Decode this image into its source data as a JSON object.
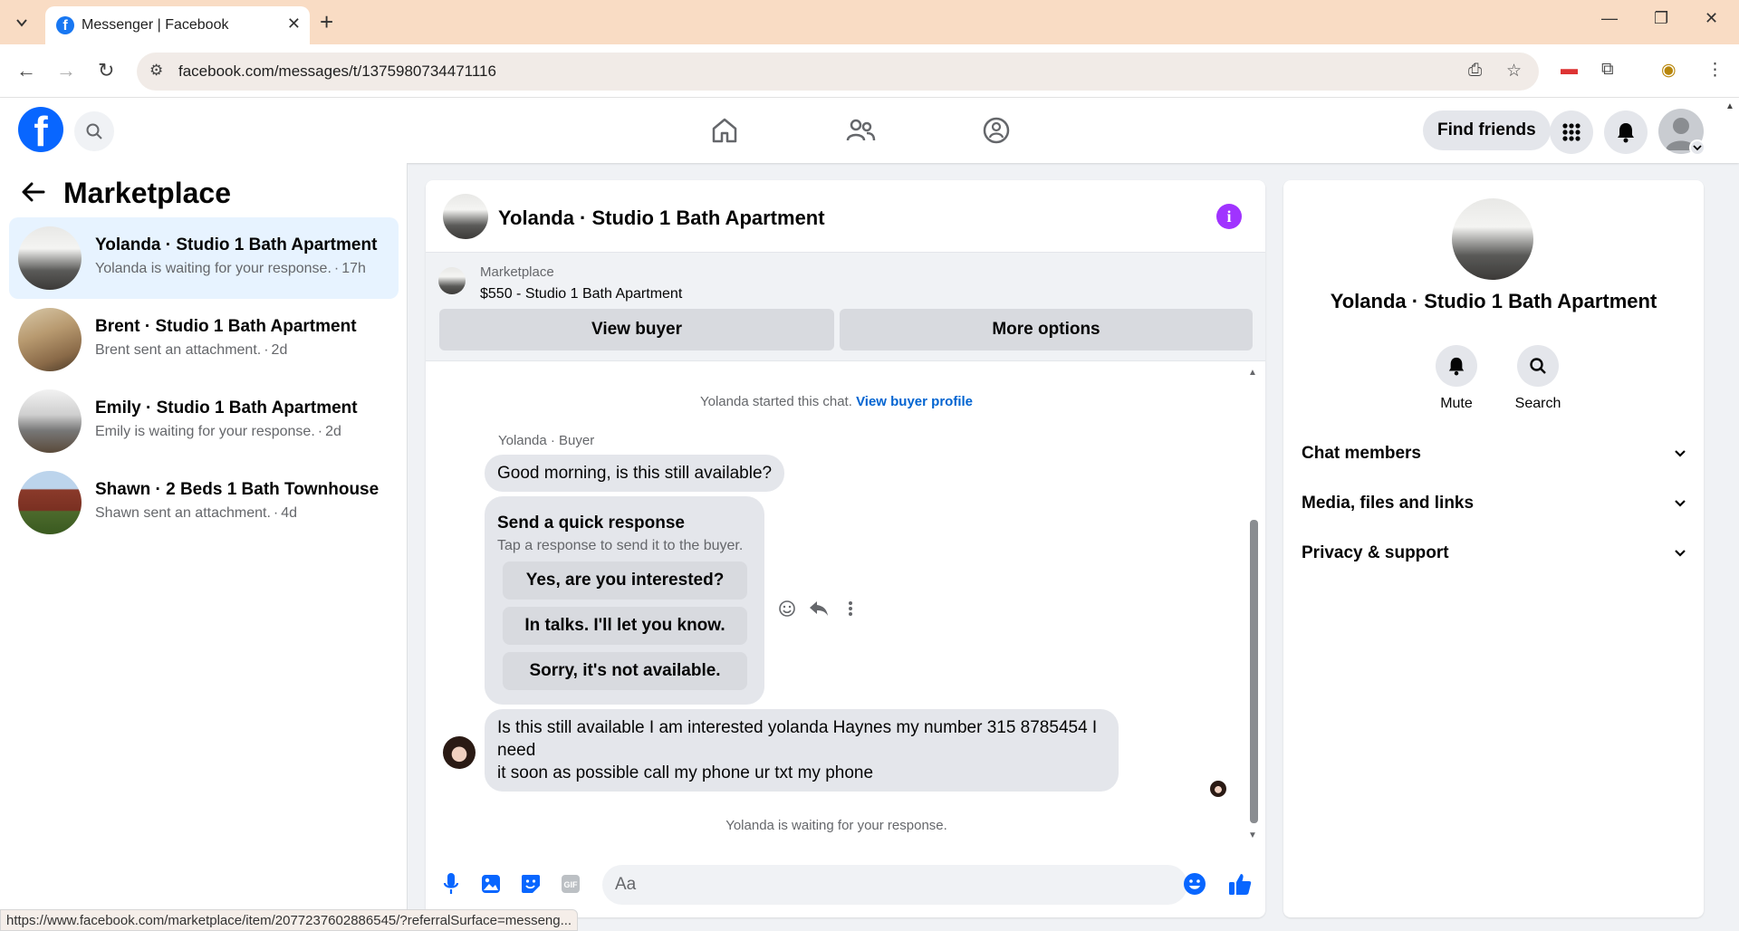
{
  "browser": {
    "tab_title": "Messenger | Facebook",
    "url": "facebook.com/messages/t/1375980734471116",
    "status_url": "https://www.facebook.com/marketplace/item/2077237602886545/?referralSurface=messeng..."
  },
  "header": {
    "find_friends_label": "Find friends"
  },
  "sidebar": {
    "title": "Marketplace",
    "conversations": [
      {
        "name": "Yolanda · Studio 1 Bath Apartment",
        "preview": "Yolanda is waiting for your response.",
        "time": "17h"
      },
      {
        "name": "Brent · Studio 1 Bath Apartment",
        "preview": "Brent sent an attachment.",
        "time": "2d"
      },
      {
        "name": "Emily · Studio 1 Bath Apartment",
        "preview": "Emily is waiting for your response.",
        "time": "2d"
      },
      {
        "name": "Shawn · 2 Beds 1 Bath Townhouse",
        "preview": "Shawn sent an attachment.",
        "time": "4d"
      }
    ],
    "separator": "·"
  },
  "chat": {
    "title": "Yolanda · Studio 1 Bath Apartment",
    "marketplace_label": "Marketplace",
    "listing": "$550 - Studio 1 Bath Apartment",
    "view_buyer_label": "View buyer",
    "more_options_label": "More options",
    "started_text": "Yolanda started this chat.",
    "view_profile_link": "View buyer profile",
    "sender_label": "Yolanda · Buyer",
    "message1": "Good morning, is this still available?",
    "quick_response": {
      "heading": "Send a quick response",
      "subtext": "Tap a response to send it to the buyer.",
      "options": [
        "Yes, are you interested?",
        "In talks. I'll let you know.",
        "Sorry, it's not available."
      ]
    },
    "message2_line1": "Is this still available I am interested yolanda Haynes my number 315 8785454 I need",
    "message2_line2": "it soon as possible call my phone ur txt my phone",
    "waiting_text": "Yolanda is waiting for your response.",
    "composer_placeholder": "Aa"
  },
  "details": {
    "name": "Yolanda · Studio 1 Bath Apartment",
    "mute_label": "Mute",
    "search_label": "Search",
    "sections": [
      "Chat members",
      "Media, files and links",
      "Privacy & support"
    ]
  },
  "colors": {
    "accent": "#0866ff",
    "active_bg": "#e7f3ff",
    "info": "#a033ff"
  }
}
